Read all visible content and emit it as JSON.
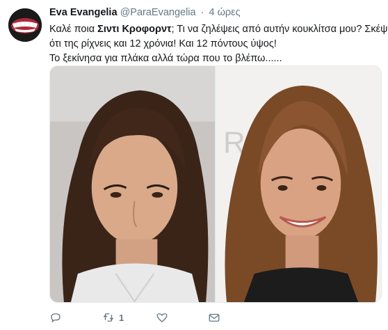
{
  "tweet": {
    "display_name": "Eva Evangelia",
    "handle": "@ParaEvangelia",
    "separator": "·",
    "time": "4 ώρες",
    "text_line1_pre": "Καλέ ποια ",
    "text_line1_bold": "Σιντι Κροφορντ",
    "text_line1_post": "; Τι να ζηλέψεις από αυτήν κουκλίτσα μου? Σκέψου",
    "text_line2": "ότι της ρίχνεις και 12 χρόνια! Και 12 πόντους ύψος!",
    "text_line3": "Το ξεκίνησα για πλάκα αλλά τώρα που το βλέπω......"
  },
  "actions": {
    "reply_icon": "reply-icon",
    "retweet_icon": "retweet-icon",
    "retweet_count": "1",
    "like_icon": "heart-icon",
    "dm_icon": "envelope-icon"
  },
  "colors": {
    "text": "#14171a",
    "secondary": "#657786",
    "border": "#e6ecf0"
  }
}
